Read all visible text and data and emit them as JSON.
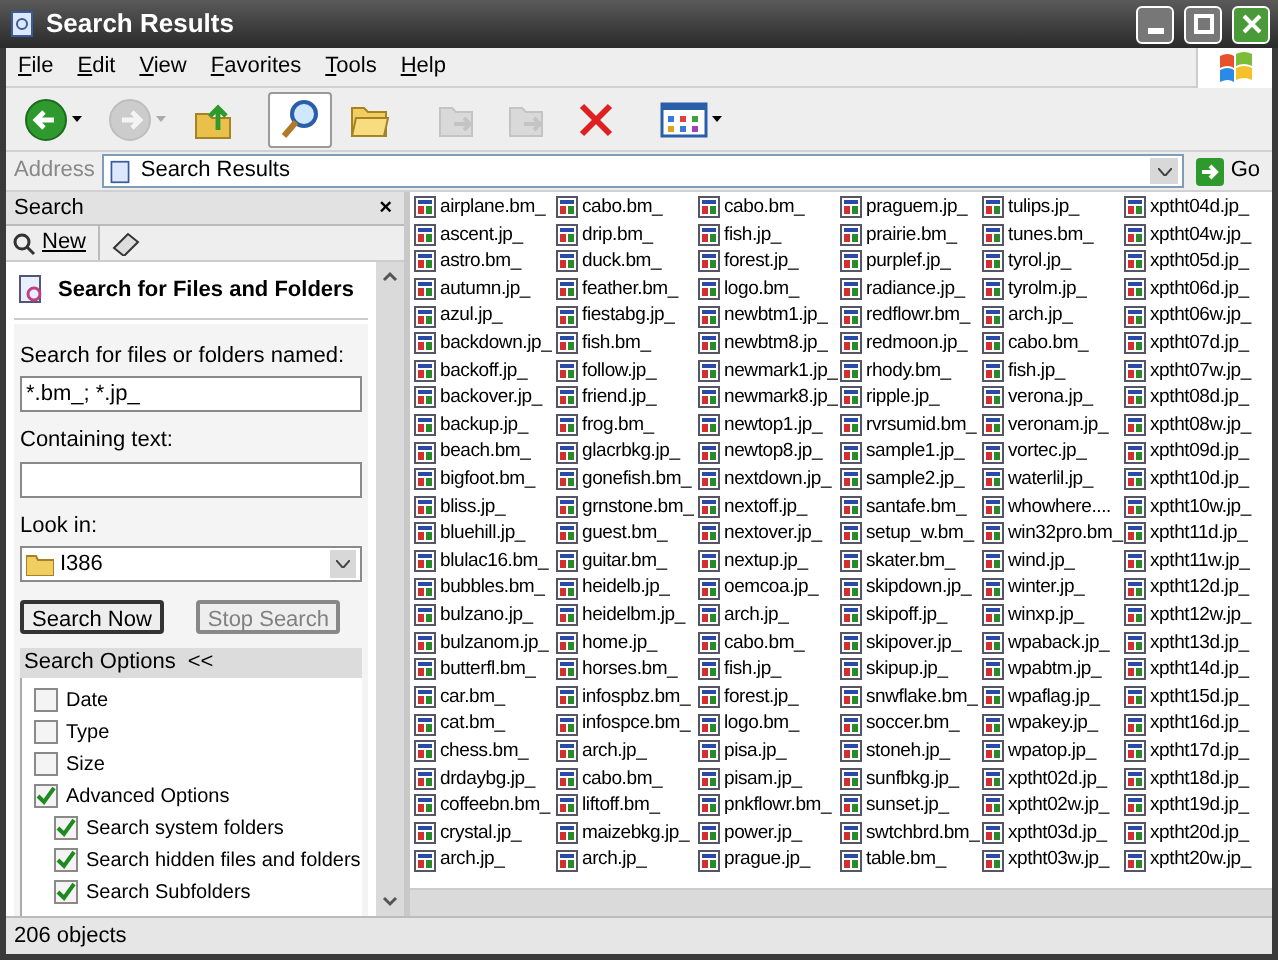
{
  "window": {
    "title": "Search Results"
  },
  "menu": [
    {
      "label": "File"
    },
    {
      "label": "Edit"
    },
    {
      "label": "View"
    },
    {
      "label": "Favorites"
    },
    {
      "label": "Tools"
    },
    {
      "label": "Help"
    }
  ],
  "toolbar": [
    {
      "kind": "back",
      "disabled": false,
      "selected": false,
      "dropdown": true
    },
    {
      "kind": "forward",
      "disabled": true,
      "selected": false,
      "dropdown": true
    },
    {
      "kind": "up",
      "disabled": false,
      "selected": false,
      "dropdown": false
    },
    {
      "kind": "search",
      "disabled": false,
      "selected": true,
      "dropdown": false
    },
    {
      "kind": "folders",
      "disabled": false,
      "selected": false,
      "dropdown": false
    },
    {
      "kind": "move",
      "disabled": true,
      "selected": false,
      "dropdown": false
    },
    {
      "kind": "copy",
      "disabled": true,
      "selected": false,
      "dropdown": false
    },
    {
      "kind": "delete",
      "disabled": false,
      "selected": false,
      "dropdown": false
    },
    {
      "kind": "views",
      "disabled": false,
      "selected": false,
      "dropdown": true
    }
  ],
  "address": {
    "label": "Address",
    "value": "Search Results",
    "go": "Go"
  },
  "search_pane": {
    "title": "Search",
    "close": "×",
    "new_button": "New",
    "heading": "Search for Files and Folders",
    "name_label": "Search for files or folders named:",
    "name_value": "*.bm_; *.jp_",
    "text_label": "Containing text:",
    "look_in_label": "Look in:",
    "look_in_value": "I386",
    "search_now": {
      "label": "Search Now",
      "disabled": false
    },
    "stop_search": {
      "label": "Stop Search",
      "disabled": true
    },
    "options_title": "Search Options",
    "options_toggle": "<<",
    "options": [
      {
        "label": "Date",
        "checked": false
      },
      {
        "label": "Type",
        "checked": false
      },
      {
        "label": "Size",
        "checked": false
      },
      {
        "label": "Advanced Options",
        "checked": true,
        "children": [
          {
            "label": "Search system folders",
            "checked": true
          },
          {
            "label": "Search hidden files and folders",
            "checked": true
          },
          {
            "label": "Search Subfolders",
            "checked": true
          }
        ]
      }
    ]
  },
  "files": [
    "airplane.bm_",
    "ascent.jp_",
    "astro.bm_",
    "autumn.jp_",
    "azul.jp_",
    "backdown.jp_",
    "backoff.jp_",
    "backover.jp_",
    "backup.jp_",
    "beach.bm_",
    "bigfoot.bm_",
    "bliss.jp_",
    "bluehill.jp_",
    "blulac16.bm_",
    "bubbles.bm_",
    "bulzano.jp_",
    "bulzanom.jp_",
    "butterfl.bm_",
    "car.bm_",
    "cat.bm_",
    "chess.bm_",
    "drdaybg.jp_",
    "coffeebn.bm_",
    "crystal.jp_",
    "arch.jp_",
    "cabo.bm_",
    "drip.bm_",
    "duck.bm_",
    "feather.bm_",
    "fiestabg.jp_",
    "fish.bm_",
    "follow.jp_",
    "friend.jp_",
    "frog.bm_",
    "glacrbkg.jp_",
    "gonefish.bm_",
    "grnstone.bm_",
    "guest.bm_",
    "guitar.bm_",
    "heidelb.jp_",
    "heidelbm.jp_",
    "home.jp_",
    "horses.bm_",
    "infospbz.bm_",
    "infospce.bm_",
    "arch.jp_",
    "cabo.bm_",
    "liftoff.bm_",
    "maizebkg.jp_",
    "arch.jp_",
    "cabo.bm_",
    "fish.jp_",
    "forest.jp_",
    "logo.bm_",
    "newbtm1.jp_",
    "newbtm8.jp_",
    "newmark1.jp_",
    "newmark8.jp_",
    "newtop1.jp_",
    "newtop8.jp_",
    "nextdown.jp_",
    "nextoff.jp_",
    "nextover.jp_",
    "nextup.jp_",
    "oemcoa.jp_",
    "arch.jp_",
    "cabo.bm_",
    "fish.jp_",
    "forest.jp_",
    "logo.bm_",
    "pisa.jp_",
    "pisam.jp_",
    "pnkflowr.bm_",
    "power.jp_",
    "prague.jp_",
    "praguem.jp_",
    "prairie.bm_",
    "purplef.jp_",
    "radiance.jp_",
    "redflowr.bm_",
    "redmoon.jp_",
    "rhody.bm_",
    "ripple.jp_",
    "rvrsumid.bm_",
    "sample1.jp_",
    "sample2.jp_",
    "santafe.bm_",
    "setup_w.bm_",
    "skater.bm_",
    "skipdown.jp_",
    "skipoff.jp_",
    "skipover.jp_",
    "skipup.jp_",
    "snwflake.bm_",
    "soccer.bm_",
    "stoneh.jp_",
    "sunfbkg.jp_",
    "sunset.jp_",
    "swtchbrd.bm_",
    "table.bm_",
    "tulips.jp_",
    "tunes.bm_",
    "tyrol.jp_",
    "tyrolm.jp_",
    "arch.jp_",
    "cabo.bm_",
    "fish.jp_",
    "verona.jp_",
    "veronam.jp_",
    "vortec.jp_",
    "waterlil.jp_",
    "whowhere....",
    "win32pro.bm_",
    "wind.jp_",
    "winter.jp_",
    "winxp.jp_",
    "wpaback.jp_",
    "wpabtm.jp_",
    "wpaflag.jp_",
    "wpakey.jp_",
    "wpatop.jp_",
    "xptht02d.jp_",
    "xptht02w.jp_",
    "xptht03d.jp_",
    "xptht03w.jp_",
    "xptht04d.jp_",
    "xptht04w.jp_",
    "xptht05d.jp_",
    "xptht06d.jp_",
    "xptht06w.jp_",
    "xptht07d.jp_",
    "xptht07w.jp_",
    "xptht08d.jp_",
    "xptht08w.jp_",
    "xptht09d.jp_",
    "xptht10d.jp_",
    "xptht10w.jp_",
    "xptht11d.jp_",
    "xptht11w.jp_",
    "xptht12d.jp_",
    "xptht12w.jp_",
    "xptht13d.jp_",
    "xptht14d.jp_",
    "xptht15d.jp_",
    "xptht16d.jp_",
    "xptht17d.jp_",
    "xptht18d.jp_",
    "xptht19d.jp_",
    "xptht20d.jp_",
    "xptht20w.jp_"
  ],
  "status_bar": {
    "text": "206 objects"
  }
}
